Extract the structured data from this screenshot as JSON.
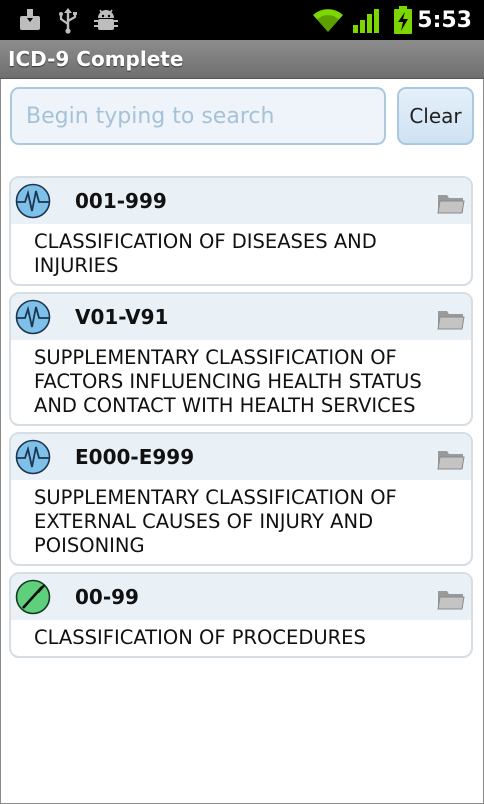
{
  "status_bar": {
    "time": "5:53",
    "icons": [
      "download-icon",
      "usb-icon",
      "android-debug-icon",
      "wifi-icon",
      "signal-icon",
      "battery-charging-icon"
    ]
  },
  "app": {
    "title": "ICD-9 Complete"
  },
  "search": {
    "placeholder": "Begin typing to search",
    "value": ""
  },
  "clear_label": "Clear",
  "colors": {
    "accent": "#a9c9e2",
    "header_bg": "#eaf1f6",
    "title_bar": "#7b7b7b"
  },
  "items": [
    {
      "code": "001-999",
      "description": "CLASSIFICATION OF DISEASES AND INJURIES",
      "icon": "pulse-icon"
    },
    {
      "code": "V01-V91",
      "description": "SUPPLEMENTARY CLASSIFICATION OF FACTORS INFLUENCING HEALTH STATUS AND CONTACT WITH HEALTH SERVICES",
      "icon": "pulse-icon"
    },
    {
      "code": "E000-E999",
      "description": "SUPPLEMENTARY CLASSIFICATION OF EXTERNAL CAUSES OF INJURY AND POISONING",
      "icon": "pulse-icon"
    },
    {
      "code": "00-99",
      "description": "CLASSIFICATION OF PROCEDURES",
      "icon": "scalpel-icon"
    }
  ]
}
